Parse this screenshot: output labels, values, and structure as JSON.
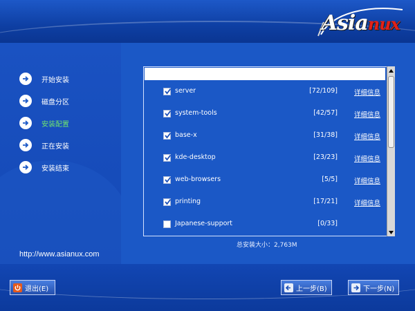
{
  "brand": {
    "logo_main": "Asia",
    "logo_accent": "nux"
  },
  "sidebar": {
    "steps": [
      {
        "label": "开始安装",
        "active": false
      },
      {
        "label": "磁盘分区",
        "active": false
      },
      {
        "label": "安装配置",
        "active": true
      },
      {
        "label": "正在安装",
        "active": false
      },
      {
        "label": "安装结束",
        "active": false
      }
    ],
    "url": "http://www.asianux.com"
  },
  "packages": {
    "detail_label": "详细信息",
    "rows": [
      {
        "name": "server",
        "count": "[72/109]",
        "checked": true,
        "detail": true
      },
      {
        "name": "system-tools",
        "count": "[42/57]",
        "checked": true,
        "detail": true
      },
      {
        "name": "base-x",
        "count": "[31/38]",
        "checked": true,
        "detail": true
      },
      {
        "name": "kde-desktop",
        "count": "[23/23]",
        "checked": true,
        "detail": true
      },
      {
        "name": "web-browsers",
        "count": "[5/5]",
        "checked": true,
        "detail": true
      },
      {
        "name": "printing",
        "count": "[17/21]",
        "checked": true,
        "detail": true
      },
      {
        "name": "Japanese-support",
        "count": "[0/33]",
        "checked": false,
        "detail": false
      }
    ]
  },
  "total": {
    "label": "总安装大小：2,763M"
  },
  "buttons": {
    "exit": "退出(E)",
    "back": "上一步(B)",
    "next": "下一步(N)"
  },
  "colors": {
    "background": "#0b3ea6",
    "panel": "#1b58c6",
    "active_step": "#6fe36f",
    "logo_accent": "#e32019"
  }
}
